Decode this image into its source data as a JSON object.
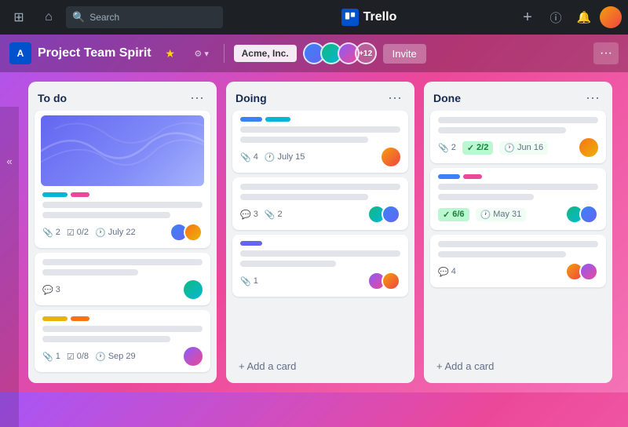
{
  "app": {
    "name": "Trello",
    "logo_text": "T"
  },
  "topnav": {
    "search_placeholder": "Search",
    "add_btn": "+",
    "info_btn": "ℹ",
    "bell_btn": "🔔",
    "home_btn": "⌂",
    "grid_btn": "⊞"
  },
  "board": {
    "title": "Project Team Spirit",
    "workspace": "Acme, Inc.",
    "invite_label": "Invite",
    "more_label": "···",
    "avatar_count": "+12"
  },
  "sidebar": {
    "toggle_label": "«"
  },
  "lists": [
    {
      "id": "todo",
      "title": "To do",
      "cards": [
        {
          "id": "card-1",
          "has_cover": true,
          "labels": [
            "cyan",
            "pink"
          ],
          "meta": {
            "attachments": "2",
            "checklist": "0/2",
            "date": "July 22"
          },
          "has_avatars": true
        },
        {
          "id": "card-2",
          "labels": [],
          "meta": {
            "comments": "3"
          },
          "has_single_avatar": true
        },
        {
          "id": "card-3",
          "labels": [
            "yellow",
            "orange"
          ],
          "meta": {
            "attachments": "1",
            "checklist": "0/8",
            "date": "Sep 29"
          },
          "has_single_avatar": true
        }
      ],
      "add_card_label": "+ Add a card"
    },
    {
      "id": "doing",
      "title": "Doing",
      "cards": [
        {
          "id": "card-4",
          "labels": [
            "blue",
            "purple"
          ],
          "meta": {
            "attachments": "4",
            "date": "July 15"
          },
          "has_single_avatar": true
        },
        {
          "id": "card-5",
          "labels": [],
          "meta": {
            "comments": "3",
            "attachments": "2"
          },
          "has_avatars": true
        },
        {
          "id": "card-6",
          "labels": [
            "indigo"
          ],
          "meta": {
            "attachments": "1"
          },
          "has_avatars": true
        }
      ],
      "add_card_label": "+ Add a card"
    },
    {
      "id": "done",
      "title": "Done",
      "cards": [
        {
          "id": "card-7",
          "labels": [],
          "meta": {
            "attachments": "2",
            "checklist_done": "2/2",
            "date": "Jun 16"
          },
          "has_single_avatar": true
        },
        {
          "id": "card-8",
          "labels": [
            "blue",
            "pink"
          ],
          "meta": {
            "checklist_done": "6/6",
            "date": "May 31"
          },
          "has_avatars": true
        },
        {
          "id": "card-9",
          "labels": [],
          "meta": {
            "comments": "4"
          },
          "has_avatars": true
        }
      ],
      "add_card_label": "+ Add a card"
    }
  ]
}
